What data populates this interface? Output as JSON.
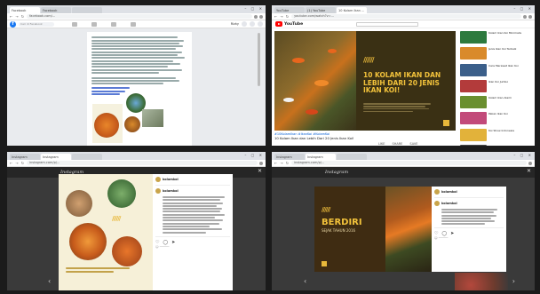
{
  "panes": [
    {
      "app": "Facebook",
      "tabs": [
        "Facebook",
        "Facebook",
        ""
      ],
      "url": "facebook.com/...",
      "search_placeholder": "Cari di Facebook",
      "user_label": "Rizky"
    },
    {
      "app": "YouTube",
      "tabs": [
        "YouTube",
        "(1) YouTube",
        "10 Kolam Ikan ..."
      ],
      "url": "youtube.com/watch?v=...",
      "logo_text": "YouTube",
      "video": {
        "stripes": "//////",
        "title": "10 KOLAM IKAN DAN LEBIH DARI 20 JENIS IKAN KOI!",
        "hashtags": "#10KolamIkan #IkanKoi #KolamKoi",
        "heading": "10 Kolam Ikan dan Lebih Dari 20 Jenis Ikan Koi!",
        "like_label": "LIKE",
        "share_label": "SHARE",
        "save_label": "SAVE"
      },
      "suggestions": [
        {
          "color": "#2d7a3e",
          "title": "Kolam Ikan Koi Minimalis"
        },
        {
          "color": "#d98a2b",
          "title": "Jenis Ikan Koi Terbaik"
        },
        {
          "color": "#3b5f8a",
          "title": "Cara Merawat Ikan Koi"
        },
        {
          "color": "#b33b3b",
          "title": "Ikan Koi Jumbo"
        },
        {
          "color": "#6a8f2f",
          "title": "Kolam Ikan Alami"
        },
        {
          "color": "#c24a7a",
          "title": "Pakan Ikan Koi"
        },
        {
          "color": "#e2b23a",
          "title": "Koi Show Indonesia"
        },
        {
          "color": "#4a4a4a",
          "title": "Kolam Koi Rumahan"
        }
      ]
    },
    {
      "app": "Instagram",
      "tabs": [
        "Instagram",
        "Instagram",
        ""
      ],
      "url": "instagram.com/p/...",
      "logo_text": "Instagram",
      "post": {
        "stripes": "//////",
        "author": "kolamkoi",
        "caption_author": "kolamkoi"
      }
    },
    {
      "app": "Instagram",
      "tabs": [
        "Instagram",
        "Instagram",
        ""
      ],
      "url": "instagram.com/p/...",
      "logo_text": "Instagram",
      "post": {
        "stripes": "//////",
        "headline": "BERDIRI",
        "subline": "SEJAK TAHUN 2016",
        "author": "kolamkoi",
        "caption_author": "kolamkoi"
      }
    }
  ],
  "colors": {
    "accent_gold": "#f2c23b",
    "youtube_red": "#ff0000",
    "facebook_blue": "#1877f2"
  }
}
